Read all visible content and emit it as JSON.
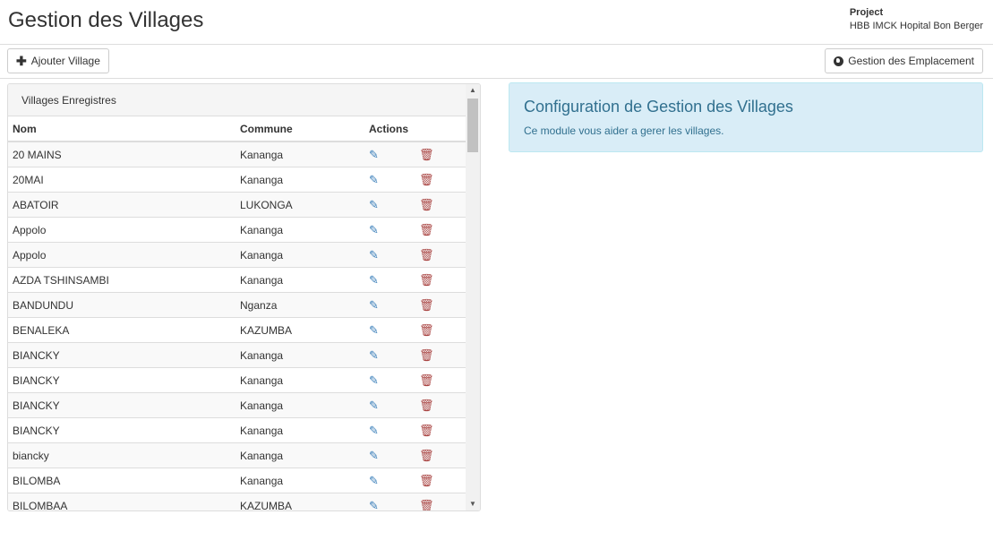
{
  "header": {
    "title": "Gestion des Villages",
    "project_label": "Project",
    "project_name": "HBB IMCK Hopital Bon Berger"
  },
  "toolbar": {
    "add_label": "Ajouter Village",
    "add_icon": "plus-icon",
    "locations_label": "Gestion des Emplacement",
    "locations_icon": "globe-icon"
  },
  "panel": {
    "title": "Villages Enregistres",
    "columns": [
      "Nom",
      "Commune",
      "Actions"
    ],
    "rows": [
      [
        "20 MAINS",
        "Kananga"
      ],
      [
        "20MAI",
        "Kananga"
      ],
      [
        "ABATOIR",
        "LUKONGA"
      ],
      [
        "Appolo",
        "Kananga"
      ],
      [
        "Appolo",
        "Kananga"
      ],
      [
        "AZDA TSHINSAMBI",
        "Kananga"
      ],
      [
        "BANDUNDU",
        "Nganza"
      ],
      [
        "BENALEKA",
        "KAZUMBA"
      ],
      [
        "BIANCKY",
        "Kananga"
      ],
      [
        "BIANCKY",
        "Kananga"
      ],
      [
        "BIANCKY",
        "Kananga"
      ],
      [
        "BIANCKY",
        "Kananga"
      ],
      [
        "biancky",
        "Kananga"
      ],
      [
        "BILOMBA",
        "Kananga"
      ],
      [
        "BILOMBAA",
        "KAZUMBA"
      ]
    ]
  },
  "info": {
    "title": "Configuration de Gestion des Villages",
    "text": "Ce module vous aider a gerer les villages."
  },
  "colors": {
    "edit": "#337ab7",
    "delete": "#a94442",
    "info_bg": "#d9edf7",
    "info_text": "#31708f"
  }
}
